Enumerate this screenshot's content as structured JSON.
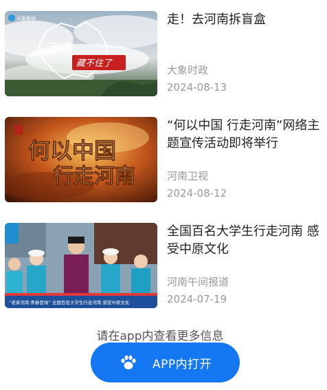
{
  "news": [
    {
      "title": "走！去河南拆盲盒",
      "source": "大象时政",
      "date": "2024-08-13",
      "thumb_text": {
        "province": "河南",
        "tagline": "藏不住了",
        "logo": "大象新闻"
      }
    },
    {
      "title": "“何以中国 行走河南”网络主题宣传活动即将举行",
      "source": "河南卫视",
      "date": "2024-08-12",
      "thumb_text": {
        "line1": "何以中国",
        "line2": "行走河南"
      }
    },
    {
      "title": "全国百名大学生行走河南 感受中原文化",
      "source": "河南午间报道",
      "date": "2024-07-19",
      "thumb_text": {
        "caption": "“老家河南·青春登场” 全国百名大学生行走河南 感受中原文化"
      }
    }
  ],
  "footer": {
    "more_hint": "请在app内查看更多信息",
    "open_app_label": "APP内打开"
  },
  "colors": {
    "accent": "#1677f2",
    "meta_text": "#999999"
  },
  "icons": {
    "open_app": "paw-icon"
  }
}
